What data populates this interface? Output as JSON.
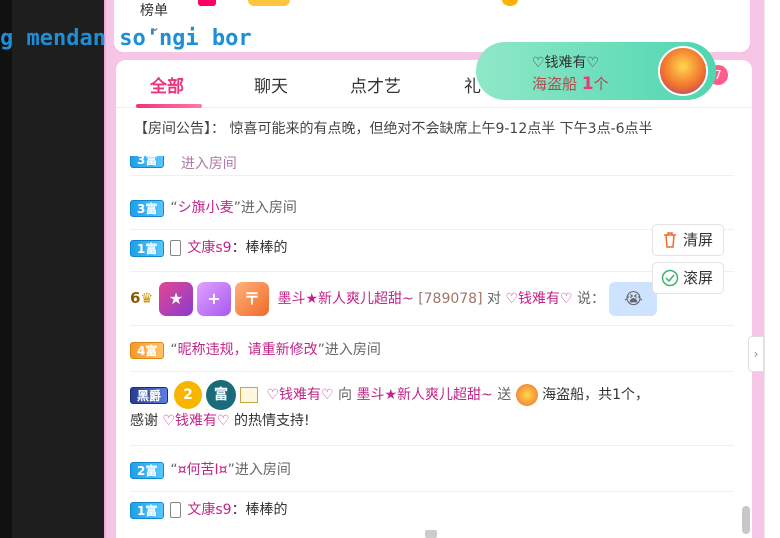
{
  "top": {
    "rank_label": "榜单",
    "chevron": "⌄"
  },
  "scroll_text": "g mendan so'ngi bor",
  "gift_bubble": {
    "line1": "♡钱难有♡",
    "line2_prefix": "海盗船 ",
    "line2_count": "1",
    "line2_suffix": "个"
  },
  "tabs": [
    {
      "label": "全部"
    },
    {
      "label": "聊天"
    },
    {
      "label": "点才艺"
    },
    {
      "label": "礼"
    }
  ],
  "tab_badge": "7",
  "notice": "【房间公告】： 惊喜可能来的有点晚，但绝对不会缺席上午9-12点半 下午3点-6点半",
  "side_buttons": {
    "clear": "清屏",
    "scroll": "滚屏"
  },
  "chat": [
    {
      "level": "3富",
      "text_pre": "“",
      "name": "シ旗小麦",
      "text_post": "”进入房间"
    },
    {
      "level": "1富",
      "name": "文康s9",
      "msg": "：棒棒的"
    },
    {
      "level_num": "6",
      "badge1": "★",
      "badge2": "+",
      "badge3": "〒",
      "name": "墨斗★新人爽儿超甜~",
      "id": "[789078]",
      "to": "对",
      "target": "♡钱难有♡",
      "say": "说："
    },
    {
      "level": "4富",
      "text_pre": "“",
      "name": "昵称违规，请重新修改",
      "text_post": "”进入房间"
    },
    {
      "badge_vip": "黑爵",
      "badge_num": "2",
      "badge_fu": "富",
      "sender": "♡钱难有♡",
      "to": "向",
      "receiver": "墨斗★新人爽儿超甜~",
      "send": "送",
      "gift": "海盗船",
      "count": "，共1个，",
      "line2_pre": "感谢",
      "line2_name": "♡钱难有♡",
      "line2_post": "的热情支持!"
    },
    {
      "level": "2富",
      "text_pre": "“",
      "name": "¤何苦I¤",
      "text_post": "”进入房间"
    },
    {
      "level": "1富",
      "name": "文康s9",
      "msg": "：棒棒的"
    }
  ],
  "partial_top_row": "进入房间"
}
